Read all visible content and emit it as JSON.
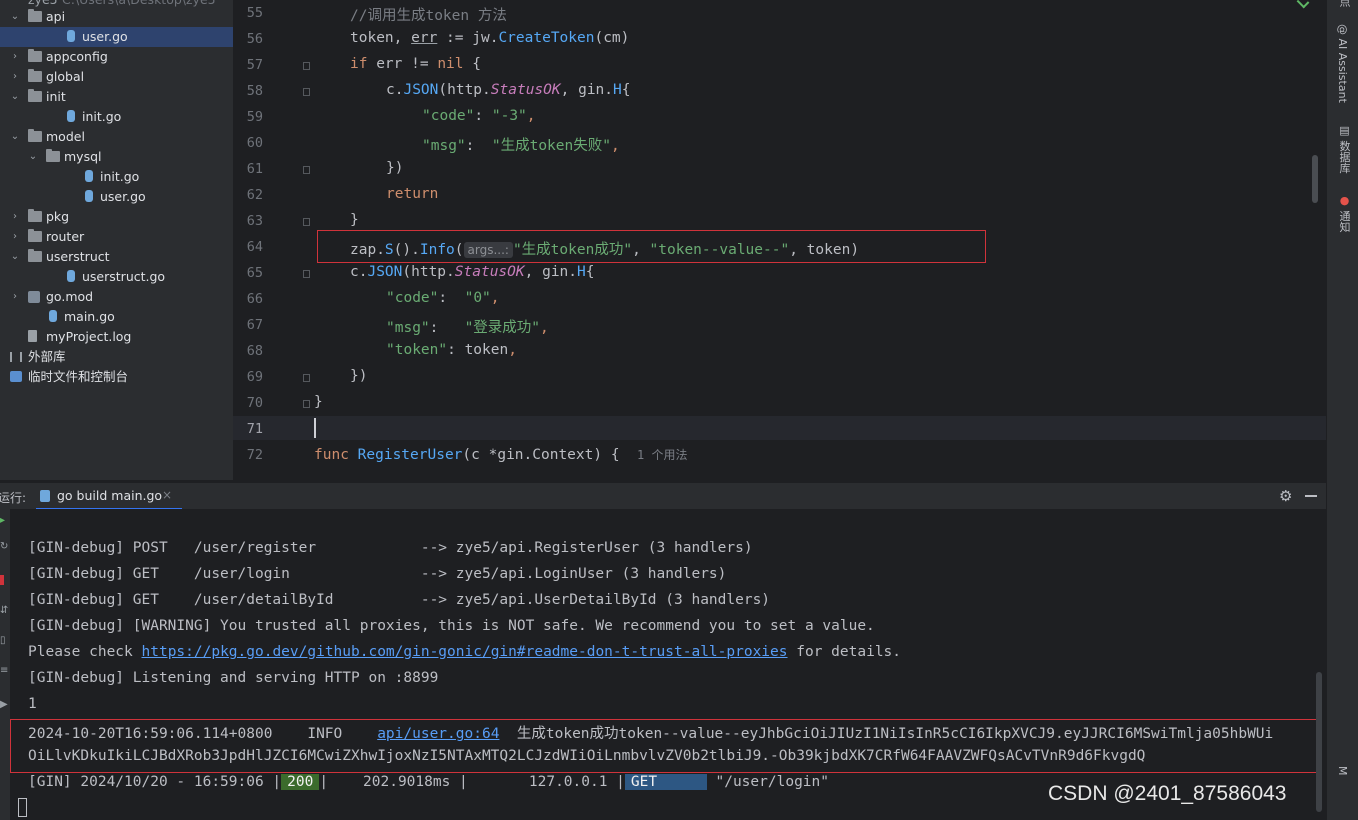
{
  "project_tree": {
    "top_partial": "zye5",
    "top_partial_path": "C:\\Users\\a\\Desktop\\zye5",
    "items": [
      {
        "label": "api",
        "type": "folder",
        "depth": 0,
        "expanded": true
      },
      {
        "label": "user.go",
        "type": "go",
        "depth": 1,
        "selected": true
      },
      {
        "label": "appconfig",
        "type": "folder",
        "depth": 0,
        "expanded": false
      },
      {
        "label": "global",
        "type": "folder",
        "depth": 0,
        "expanded": false
      },
      {
        "label": "init",
        "type": "folder",
        "depth": 0,
        "expanded": true
      },
      {
        "label": "init.go",
        "type": "go",
        "depth": 1
      },
      {
        "label": "model",
        "type": "folder",
        "depth": 0,
        "expanded": true
      },
      {
        "label": "mysql",
        "type": "folder",
        "depth": 1,
        "expanded": true
      },
      {
        "label": "init.go",
        "type": "go",
        "depth": 2
      },
      {
        "label": "user.go",
        "type": "go",
        "depth": 2
      },
      {
        "label": "pkg",
        "type": "folder",
        "depth": 0,
        "expanded": false
      },
      {
        "label": "router",
        "type": "folder",
        "depth": 0,
        "expanded": false
      },
      {
        "label": "userstruct",
        "type": "folder",
        "depth": 0,
        "expanded": true
      },
      {
        "label": "userstruct.go",
        "type": "go",
        "depth": 1
      },
      {
        "label": "go.mod",
        "type": "gomod",
        "depth": 0,
        "expanded": false
      },
      {
        "label": "main.go",
        "type": "go",
        "depth": 0
      },
      {
        "label": "myProject.log",
        "type": "log",
        "depth": 0
      },
      {
        "label": "外部库",
        "type": "lib",
        "depth": -1
      },
      {
        "label": "临时文件和控制台",
        "type": "scratch",
        "depth": -1
      }
    ]
  },
  "editor": {
    "line_numbers": [
      "55",
      "56",
      "57",
      "58",
      "59",
      "60",
      "61",
      "62",
      "63",
      "64",
      "65",
      "66",
      "67",
      "68",
      "69",
      "70",
      "71",
      "72"
    ],
    "current_line": "71",
    "code": {
      "l55_comment": "//调用生成token 方法",
      "l56_a": "token",
      "l56_b": ", ",
      "l56_c": "err",
      "l56_d": " := jw.",
      "l56_fn": "CreateToken",
      "l56_e": "(cm)",
      "l57_kw": "if",
      "l57_a": " err != ",
      "l57_nil": "nil",
      "l57_b": " {",
      "l58_a": "c.",
      "l58_fn": "JSON",
      "l58_b": "(http.",
      "l58_it": "StatusOK",
      "l58_c": ", gin.",
      "l58_h": "H",
      "l58_d": "{",
      "l59_key": "\"code\"",
      "l59_colon": ": ",
      "l59_val": "\"-3\"",
      "l59_comma": ",",
      "l60_key": "\"msg\"",
      "l60_colon": ":  ",
      "l60_val": "\"生成token失败\"",
      "l60_comma": ",",
      "l61": "})",
      "l62_kw": "return",
      "l63": "}",
      "l64_a": "zap.",
      "l64_s": "S",
      "l64_b": "().",
      "l64_info": "Info",
      "l64_c": "(",
      "l64_hint": "args...:",
      "l64_str1": "\"生成token成功\"",
      "l64_d": ", ",
      "l64_str2": "\"token--value--\"",
      "l64_e": ", token)",
      "l65_a": "c.",
      "l65_fn": "JSON",
      "l65_b": "(http.",
      "l65_it": "StatusOK",
      "l65_c": ", gin.",
      "l65_h": "H",
      "l65_d": "{",
      "l66_key": "\"code\"",
      "l66_colon": ":  ",
      "l66_val": "\"0\"",
      "l66_comma": ",",
      "l67_key": "\"msg\"",
      "l67_colon": ":   ",
      "l67_val": "\"登录成功\"",
      "l67_comma": ",",
      "l68_key": "\"token\"",
      "l68_a": ": token",
      "l68_comma": ",",
      "l69": "})",
      "l70": "}",
      "l72_kw": "func",
      "l72_fn": "RegisterUser",
      "l72_a": "(c *gin.",
      "l72_ctx": "Context",
      "l72_b": ") {",
      "l72_hint": "1 个用法"
    }
  },
  "right_strip": {
    "ai_assistant": "AI Assistant",
    "database": "数据库",
    "notifications": "通知"
  },
  "run_panel": {
    "run_label": "运行:",
    "tab_label": "go build main.go"
  },
  "console": {
    "l1": "[GIN-debug] POST   /user/register            --> zye5/api.RegisterUser (3 handlers)",
    "l2": "[GIN-debug] GET    /user/login               --> zye5/api.LoginUser (3 handlers)",
    "l3": "[GIN-debug] GET    /user/detailById          --> zye5/api.UserDetailById (3 handlers)",
    "l4": "[GIN-debug] [WARNING] You trusted all proxies, this is NOT safe. We recommend you to set a value.",
    "l5_a": "Please check ",
    "l5_link": "https://pkg.go.dev/github.com/gin-gonic/gin#readme-don-t-trust-all-proxies",
    "l5_b": " for details.",
    "l6": "[GIN-debug] Listening and serving HTTP on :8899",
    "l7": "1",
    "l8_a": "2024-10-20T16:59:06.114+0800    INFO    ",
    "l8_link": "api/user.go:64",
    "l8_b": "  生成token成功token--value--eyJhbGciOiJIUzI1NiIsInR5cCI6IkpXVCJ9.eyJJRCI6MSwiTmlja05hbWUi",
    "l9": "OiLlvKDkuIkiLCJBdXRob3JpdHlJZCI6MCwiZXhwIjoxNzI5NTAxMTQ2LCJzdWIiOiLnmbvlvZV0b2tlbiJ9.-Ob39kjbdXK7CRfW64FAAVZWFQsACvTVnR9d6FkvgdQ",
    "l10_a": "[GIN] 2024/10/20 - 16:59:06 |",
    "l10_status": "200",
    "l10_b": "|    202.9018ms |       127.0.0.1 |",
    "l10_method": "GET     ",
    "l10_c": " \"/user/login\""
  },
  "watermark": "CSDN @2401_87586043"
}
